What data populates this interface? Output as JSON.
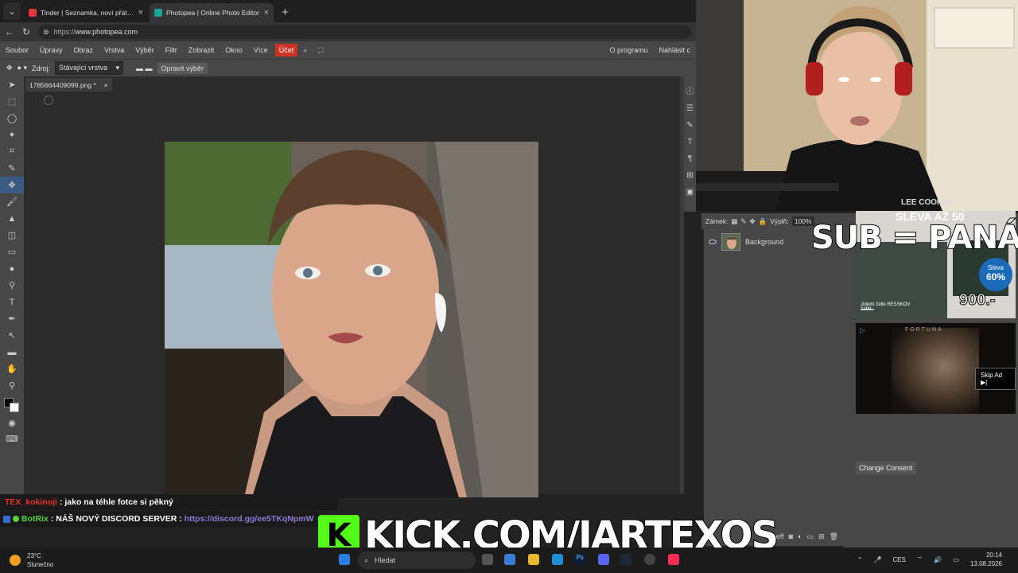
{
  "browser": {
    "tabs": [
      {
        "title": "Tinder | Seznamka, noví přátelé, n",
        "active": false
      },
      {
        "title": "Photopea | Online Photo Editor",
        "active": true
      }
    ],
    "url_scheme": "https://",
    "url_host": "www.photopea.com"
  },
  "photopea": {
    "menu": [
      "Soubor",
      "Úpravy",
      "Obraz",
      "Vrstva",
      "Výběr",
      "Filtr",
      "Zobrazit",
      "Okno",
      "Více"
    ],
    "account_label": "Účet",
    "menu_right": [
      "O programu",
      "Nahlásit c"
    ],
    "options": {
      "source_label": "Zdroj:",
      "source_value": "Stávající vrstva",
      "fix_selection_label": "Opravit výběr"
    },
    "document_tab": "1785664409099.png *",
    "layers_header": {
      "lock_label": "Zámek:",
      "fill_label": "Výplň:",
      "fill_value": "100%"
    },
    "layers": [
      {
        "name": "Background"
      }
    ]
  },
  "ads": {
    "furniture": {
      "headline": "SLEVA AŽ 50",
      "desc": "Jídelní židle RESSKOV",
      "old_price": "2299,-",
      "badge_label": "Sleva",
      "badge_value": "60%",
      "price": "900.-"
    },
    "video": {
      "brand": "FORTUNA",
      "skip_label": "Skip Ad ▶|"
    },
    "consent_button": "Change Consent"
  },
  "overlay": {
    "sub_text": "SUB = PANÁK",
    "kick_text": "KICK.COM/JARTEXOS",
    "webcam_shirt_text": "LEE COOPER"
  },
  "chat": [
    {
      "user": "TEX_kokinoji",
      "message": ": jako na téhle fotce si pěkný"
    },
    {
      "user": "BotRix",
      "message": ": NÁŠ NOVÝ DISCORD SERVER : ",
      "link": "https://discord.gg/ee5TKqNpmW"
    }
  ],
  "taskbar": {
    "temperature": "23°C",
    "weather": "Slunečno",
    "search_placeholder": "Hledat",
    "language": "CES",
    "time": "20:14",
    "date": "13.08.2026"
  },
  "colors": {
    "accent_account": "#cc3322",
    "kick_green": "#53fc18",
    "chat_user_red": "#e8322a",
    "chat_user_green": "#52d33a"
  }
}
